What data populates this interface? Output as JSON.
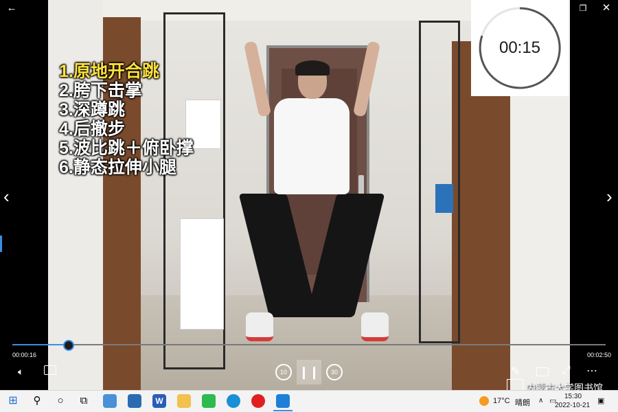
{
  "window": {
    "back_icon": "back-arrow-icon",
    "minimize_icon": "minimize-icon",
    "maximize_icon": "maximize-icon",
    "close_icon": "close-icon"
  },
  "overlay": {
    "exercises": [
      "1.原地开合跳",
      "2.胯下击掌",
      "3.深蹲跳",
      "4.后撤步",
      "5.波比跳＋俯卧撑",
      "6.静态拉伸小腿"
    ],
    "active_index": 0,
    "active_color": "#ffe23b",
    "timer": {
      "text": "00:15"
    }
  },
  "player": {
    "current_time": "00:00:16",
    "total_time": "00:02:50",
    "progress": 0.094,
    "accent": "#3a8ee6",
    "skip_back_label": "10",
    "skip_forward_label": "30"
  },
  "watermark": {
    "text": "内蒙古大学图书馆"
  },
  "taskbar": {
    "weather_temp": "17°C",
    "weather_desc": "晴朗",
    "clock_time": "15:30",
    "clock_date": "2022-10-21"
  }
}
